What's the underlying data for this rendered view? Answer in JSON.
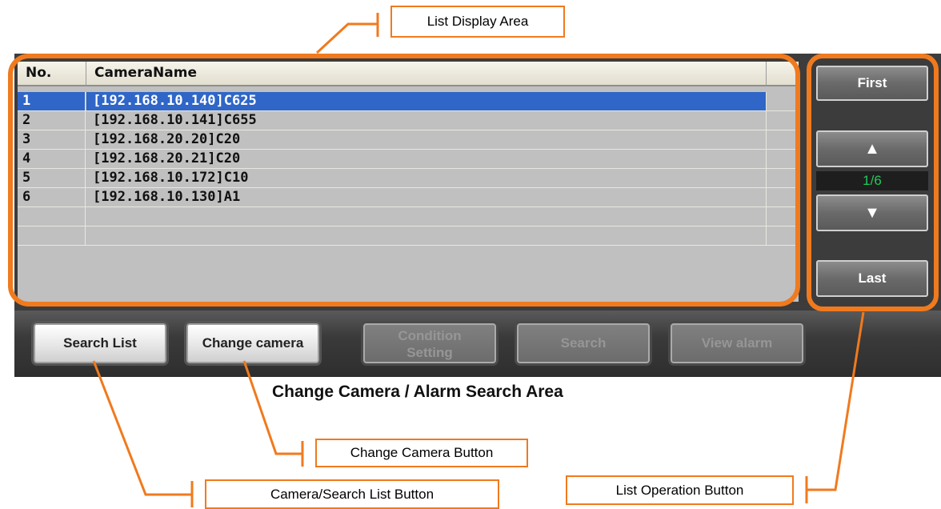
{
  "list": {
    "headers": {
      "no": "No.",
      "name": "CameraName"
    },
    "rows": [
      {
        "no": "1",
        "name": "[192.168.10.140]C625",
        "selected": true
      },
      {
        "no": "2",
        "name": "[192.168.10.141]C655",
        "selected": false
      },
      {
        "no": "3",
        "name": "[192.168.20.20]C20",
        "selected": false
      },
      {
        "no": "4",
        "name": "[192.168.20.21]C20",
        "selected": false
      },
      {
        "no": "5",
        "name": "[192.168.10.172]C10",
        "selected": false
      },
      {
        "no": "6",
        "name": "[192.168.10.130]A1",
        "selected": false
      },
      {
        "no": "",
        "name": "",
        "selected": false
      },
      {
        "no": "",
        "name": "",
        "selected": false
      }
    ]
  },
  "list_ops": {
    "first_label": "First",
    "up_label": "▲",
    "page_indicator": "1/6",
    "down_label": "▼",
    "last_label": "Last"
  },
  "bottom_buttons": {
    "search_list": "Search List",
    "change_camera": "Change camera",
    "condition_line1": "Condition",
    "condition_line2": "Setting",
    "search": "Search",
    "view_alarm": "View alarm"
  },
  "annotations": {
    "list_display_area": "List Display Area",
    "change_camera_alarm_area": "Change Camera / Alarm Search Area",
    "change_camera_button": "Change Camera Button",
    "list_operation_button": "List Operation Button",
    "camera_search_list_button": "Camera/Search List Button"
  },
  "colors": {
    "accent_orange": "#f07a1e",
    "selection_blue": "#2f66c8",
    "page_indicator_green": "#22c85a"
  }
}
